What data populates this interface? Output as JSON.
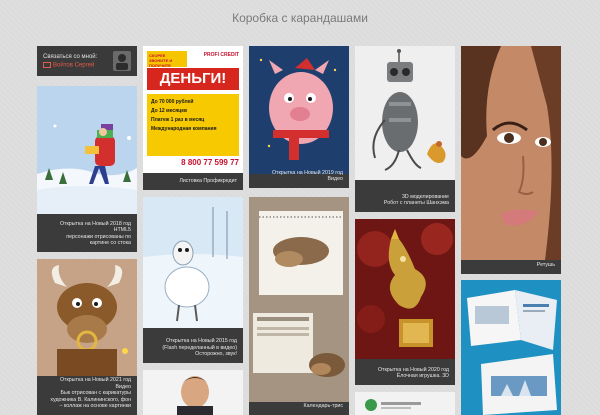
{
  "site": {
    "title": "Коробка с карандашами"
  },
  "contact": {
    "label": "Связаться со мной:",
    "link_text": "Войтов Сергей"
  },
  "cards": [
    {
      "caption": "Открытка на Новый 2018 год\nHTML5\nперсонажи отрисованы по\nкартине со стока"
    },
    {
      "caption": "Открытка на Новый 2021 год\nВидео\nБык отрисован с карикатуры\nхудожника В. Калининского, фон\n– коллаж на основе картинки"
    },
    {
      "caption": "Листовка Профикредит",
      "flyer": {
        "brand": "PROFI CREDIT",
        "headline_small": "СКОРЕЕ ЗВОНИТЕ И ПОЛУЧИТЕ",
        "headline": "ДЕНЬГИ!",
        "bullets": [
          "До 70 000 рублей",
          "До 12 месяцев",
          "Платеж 1 раз в месяц",
          "Международная компания"
        ],
        "phone": "8 800 77 599 77"
      }
    },
    {
      "caption": "Открытка на Новый 2015 год\n(Flash переделанный в видео)\nОсторожно, звук!"
    },
    {
      "caption": "Открытка на Новый 2019 год\nВидео"
    },
    {
      "caption": "Календарь-триc"
    },
    {
      "caption": "3D моделирование\nРобот с планеты Шанхэма"
    },
    {
      "caption": "Открытка на Новый 2020 год\nЁлочная игрушка. 3D"
    },
    {
      "caption": "Ретушь"
    },
    {
      "caption": ""
    },
    {
      "caption": ""
    }
  ]
}
